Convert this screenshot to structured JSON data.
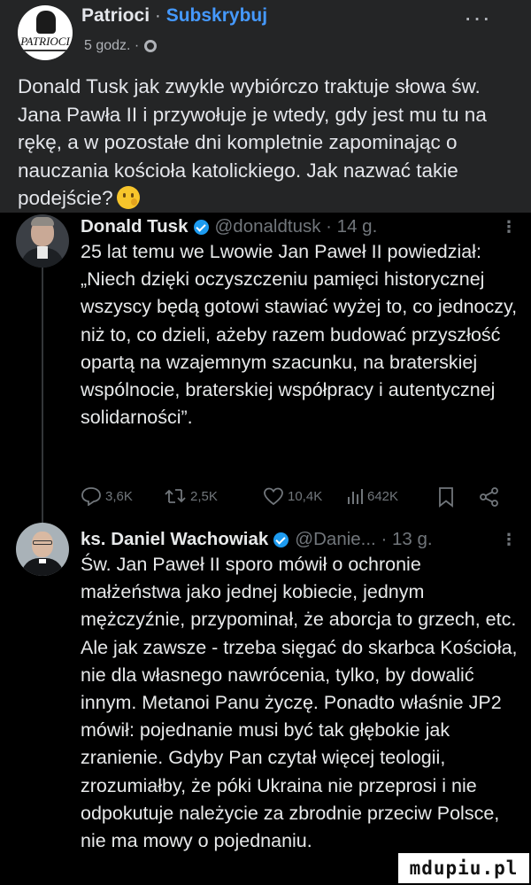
{
  "post": {
    "page_name": "Patrioci",
    "separator": "·",
    "subscribe_label": "Subskrybuj",
    "time": "5 godz. ·",
    "more_label": "···",
    "avatar_logo_text": "PATRIOCI",
    "text": "Donald Tusk jak zwykle wybiórczo traktuje słowa św. Jana Pawła II i przywołuje je wtedy, gdy jest mu tu na rękę, a w pozostałe dni kompletnie zapominając o nauczania kościoła katolickiego. Jak nazwać takie podejście?",
    "emoji": "thinking-face-icon"
  },
  "tweets": [
    {
      "name": "Donald Tusk",
      "handle": "@donaldtusk · 14 g.",
      "menu": "⋮",
      "text": "25 lat temu we Lwowie Jan Paweł II powiedział: „Niech dzięki oczyszczeniu pamięci historycznej wszyscy będą gotowi stawiać wyżej to, co jednoczy, niż to, co dzieli, ażeby razem budować przyszłość opartą na wzajemnym szacunku, na braterskiej wspólnocie, braterskiej współpracy i autentycznej solidarności”.",
      "actions": {
        "replies": "3,6K",
        "retweets": "2,5K",
        "likes": "10,4K",
        "views": "642K"
      }
    },
    {
      "name": "ks. Daniel Wachowiak",
      "handle": "@Danie... · 13 g.",
      "menu": "⋮",
      "text": "Św. Jan Paweł II sporo mówił o ochronie małżeństwa jako jednej kobiecie, jednym mężczyźnie, przypominał, że aborcja to grzech, etc. Ale jak zawsze - trzeba sięgać do skarbca Kościoła, nie dla własnego nawrócenia, tylko, by dowalić innym. Metanoi Panu życzę. Ponadto właśnie JP2 mówił: pojednanie musi być tak głębokie jak zranienie. Gdyby Pan czytał więcej teologii, zrozumiałby, że póki Ukraina nie przeprosi i nie odpokutuje należycie za zbrodnie przeciw Polsce, nie ma mowy o pojednaniu."
    }
  ],
  "watermark": "mdupiu.pl",
  "colors": {
    "fb_bg": "#242526",
    "tweet_bg": "#000000",
    "link_blue": "#4599ff",
    "verified_blue": "#1d9bf0",
    "muted_text": "#71767b"
  }
}
